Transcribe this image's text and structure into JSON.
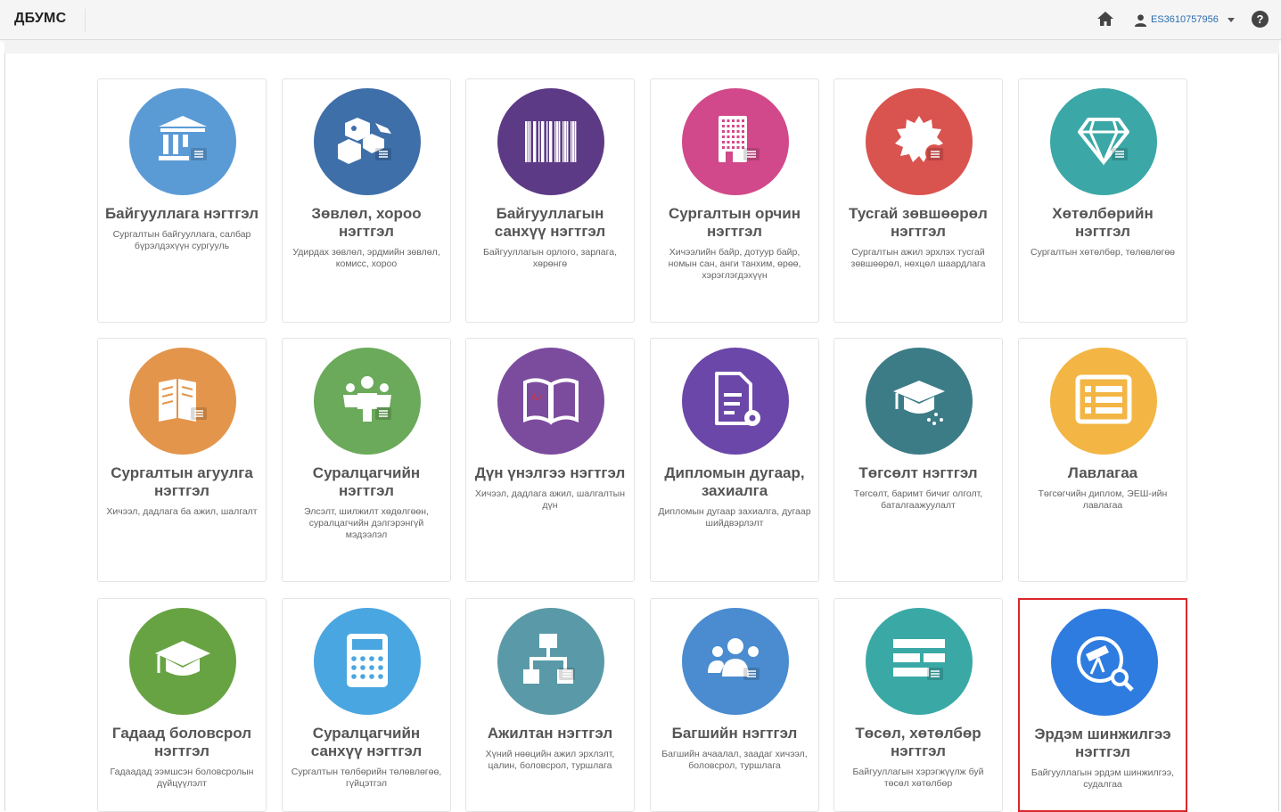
{
  "header": {
    "brand": "ДБУМС",
    "user": "ES3610757956",
    "help": "?"
  },
  "tiles": [
    {
      "title": "Байгууллага нэгтгэл",
      "desc": "Сургалтын байгууллага, салбар бүрэлдэхүүн сургууль",
      "color": "#5b9bd5",
      "icon": "bank-icon"
    },
    {
      "title": "Зөвлөл, хороо нэгтгэл",
      "desc": "Удирдах зөвлөл, эрдмийн зөвлөл, комисс, хороо",
      "color": "#3e6fa9",
      "icon": "cubes-icon"
    },
    {
      "title": "Байгууллагын санхүү нэгтгэл",
      "desc": "Байгууллагын орлого, зарлага, хөрөнгө",
      "color": "#5d3a85",
      "icon": "barcode-icon"
    },
    {
      "title": "Сургалтын орчин нэгтгэл",
      "desc": "Хичээлийн байр, дотуур байр, номын сан, анги танхим, өрөө, хэрэглэгдэхүүн",
      "color": "#d1498a",
      "icon": "building-icon"
    },
    {
      "title": "Тусгай зөвшөөрөл нэгтгэл",
      "desc": "Сургалтын ажил эрхлэх тусгай зөвшөөрөл, нөхцөл шаардлага",
      "color": "#d9534f",
      "icon": "seal-icon"
    },
    {
      "title": "Хөтөлбөрийн нэгтгэл",
      "desc": "Сургалтын хөтөлбөр, төлөвлөгөө",
      "color": "#3ba7a7",
      "icon": "diamond-icon"
    },
    {
      "title": "Сургалтын агуулга нэгтгэл",
      "desc": "Хичээл, дадлага ба ажил, шалгалт",
      "color": "#e3954c",
      "icon": "book-icon"
    },
    {
      "title": "Суралцагчийн нэгтгэл",
      "desc": "Элсэлт, шилжилт хөдөлгөөн, суралцагчийн дэлгэрэнгүй мэдээлэл",
      "color": "#6aaa5a",
      "icon": "students-icon"
    },
    {
      "title": "Дүн үнэлгээ нэгтгэл",
      "desc": "Хичээл, дадлага ажил, шалгалтын дүн",
      "color": "#7b4c9e",
      "icon": "open-book-icon"
    },
    {
      "title": "Дипломын дугаар, захиалга",
      "desc": "Дипломын дугаар захиалга, дугаар шийдвэрлэлт",
      "color": "#6a47a8",
      "icon": "document-gear-icon"
    },
    {
      "title": "Төгсөлт нэгтгэл",
      "desc": "Төгсөлт, баримт бичиг олголт, баталгаажуулалт",
      "color": "#3c7c86",
      "icon": "graduation-icon"
    },
    {
      "title": "Лавлагаа",
      "desc": "Төгсөгчийн диплом, ЭЕШ-ийн лавлагаа",
      "color": "#f3b544",
      "icon": "list-icon"
    },
    {
      "title": "Гадаад боловсрол нэгтгэл",
      "desc": "Гадаадад ээмшсэн боловсролын дүйцүүлэлт",
      "color": "#68a343",
      "icon": "mortarboard-icon"
    },
    {
      "title": "Суралцагчийн санхүү нэгтгэл",
      "desc": "Сургалтын төлбөрийн төлөвлөгөө, гүйцэтгэл",
      "color": "#4aa6e0",
      "icon": "calculator-icon"
    },
    {
      "title": "Ажилтан нэгтгэл",
      "desc": "Хүний нөөцийн ажил эрхлэлт, цалин, боловсрол, туршлага",
      "color": "#5a9aa8",
      "icon": "org-chart-icon"
    },
    {
      "title": "Багшийн нэгтгэл",
      "desc": "Багшийн ачаалал, заадаг хичээл, боловсрол, туршлага",
      "color": "#4a8ccf",
      "icon": "users-icon"
    },
    {
      "title": "Төсөл, хөтөлбөр нэгтгэл",
      "desc": "Байгууллагын хэрэгжүүлж буй төсөл хөтөлбөр",
      "color": "#3aa9a6",
      "icon": "bars-icon"
    },
    {
      "title": "Эрдэм шинжилгээ нэгтгэл",
      "desc": "Байгууллагын эрдэм шинжилгээ, судалгаа",
      "color": "#2f7ce0",
      "icon": "telescope-icon"
    }
  ]
}
